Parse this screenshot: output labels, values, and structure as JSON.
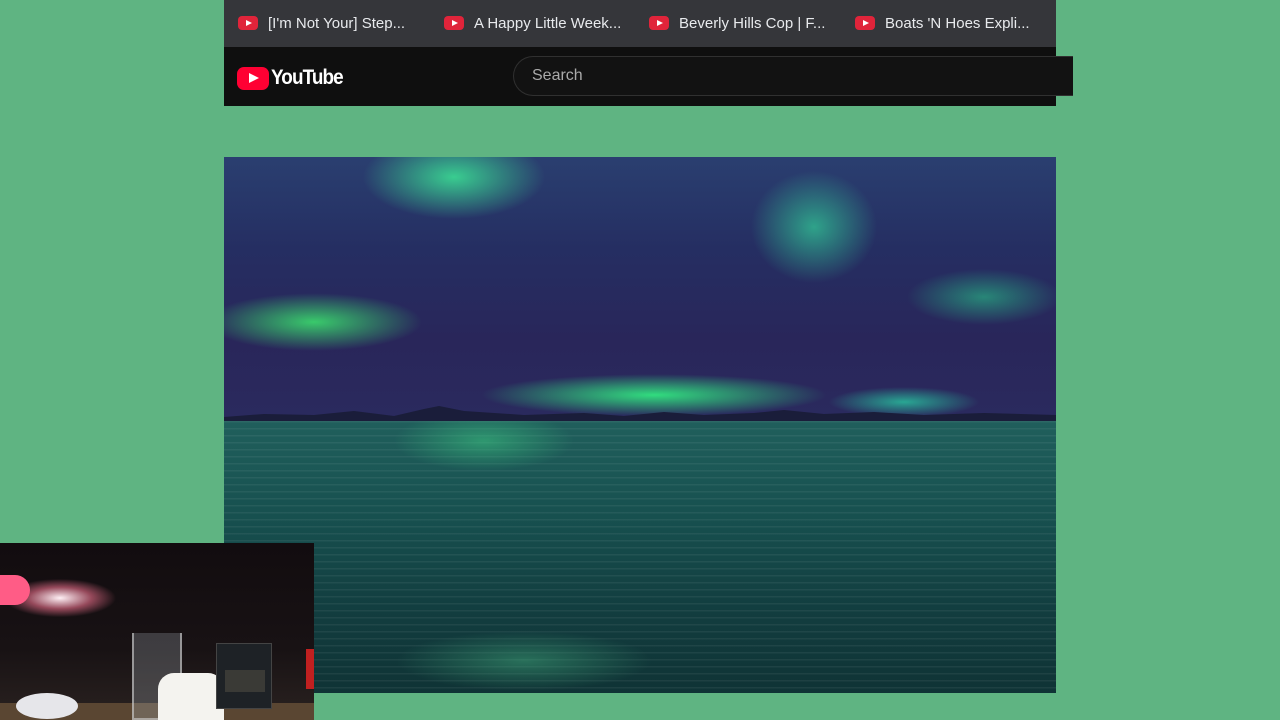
{
  "bookmarks": [
    {
      "label": "[I'm Not Your] Step...",
      "icon": "youtube-icon"
    },
    {
      "label": "A Happy Little Week...",
      "icon": "youtube-icon"
    },
    {
      "label": "Beverly Hills Cop | F...",
      "icon": "youtube-icon"
    },
    {
      "label": "Boats 'N Hoes Expli...",
      "icon": "youtube-icon"
    }
  ],
  "youtube": {
    "logo_text": "YouTube",
    "search_placeholder": "Search"
  },
  "colors": {
    "page_background": "#5fb482",
    "bookmark_bar": "#35363a",
    "youtube_header": "#0f0f0f",
    "youtube_red": "#ff0033"
  },
  "video": {
    "scene": "aurora-over-water",
    "icon": "video-player"
  },
  "webcam": {
    "icon": "webcam-overlay"
  }
}
